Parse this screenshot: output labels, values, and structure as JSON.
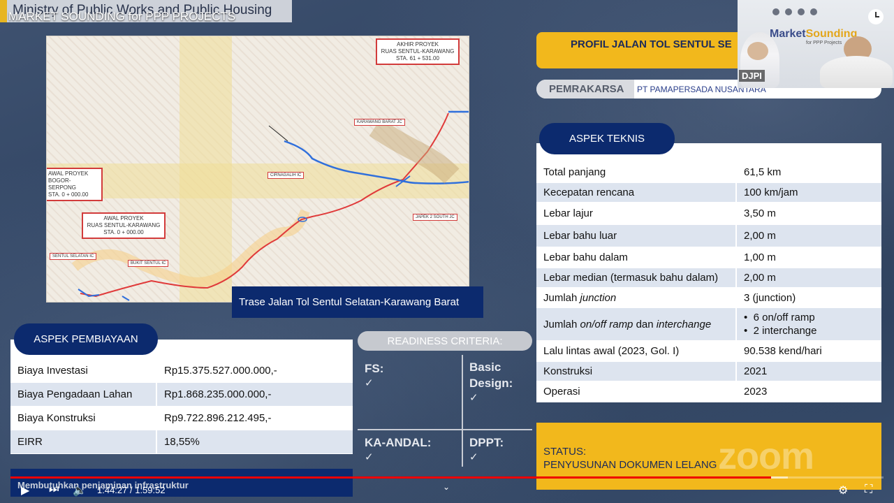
{
  "header": {
    "ministry": "Ministry of Public Works and Public Housing",
    "video_title": "MARKET SOUNDING for PPP PROJECTS"
  },
  "map": {
    "caption": "Trase Jalan Tol Sentul Selatan-Karawang Barat",
    "labels": {
      "akhir": [
        "AKHIR PROYEK",
        "RUAS SENTUL-KARAWANG",
        "STA. 61 + 531.00"
      ],
      "awal_bogor": [
        "AWAL PROYEK",
        "BOGOR-SERPONG",
        "STA. 0 + 000.00"
      ],
      "awal_sentul": [
        "AWAL PROYEK",
        "RUAS SENTUL-KARAWANG",
        "STA. 0 + 000.00"
      ],
      "karawang_barat": "KARAWANG BARAT JC",
      "cirinagalih": "CIRNAGALIH IC",
      "japek": "JAPEK 2 SOUTH JC",
      "sentul_selatan": "SENTUL SELATAN IC",
      "bukit_sentul": "BUKIT SENTUL IC"
    }
  },
  "profil": {
    "title": "PROFIL JALAN TOL SENTUL SE",
    "pemrakarsa_label": "PEMRAKARSA",
    "pemrakarsa_value": "PT PAMAPERSADA NUSANTARA"
  },
  "teknis": {
    "title": "ASPEK TEKNIS",
    "rows": [
      {
        "label": "Total panjang",
        "value": "61,5 km"
      },
      {
        "label": "Kecepatan rencana",
        "value": "100 km/jam"
      },
      {
        "label": "Lebar lajur",
        "value": "3,50 m"
      },
      {
        "label": "Lebar bahu luar",
        "value": "2,00 m"
      },
      {
        "label": "Lebar bahu dalam",
        "value": "1,00 m"
      },
      {
        "label": "Lebar median (termasuk bahu dalam)",
        "value": "2,00 m"
      },
      {
        "label_pre": "Jumlah ",
        "label_em": "junction",
        "value": "3 (junction)"
      },
      {
        "label_pre": "Jumlah ",
        "label_em": "on/off ramp",
        "label_mid": " dan ",
        "label_em2": "interchange",
        "value_1": "6 on/off ramp",
        "value_2": "2 interchange"
      },
      {
        "label": "Lalu lintas awal (2023, Gol. I)",
        "value": "90.538 kend/hari"
      },
      {
        "label": "Konstruksi",
        "value": "2021"
      },
      {
        "label": "Operasi",
        "value": "2023"
      }
    ]
  },
  "status": {
    "line1": "STATUS:",
    "line2": "PENYUSUNAN DOKUMEN LELANG"
  },
  "pembiayaan": {
    "title": "ASPEK PEMBIAYAAN",
    "rows": [
      {
        "label": "Biaya Investasi",
        "value": "Rp15.375.527.000.000,-"
      },
      {
        "label": "Biaya Pengadaan Lahan",
        "value": "Rp1.868.235.000.000,-"
      },
      {
        "label": "Biaya Konstruksi",
        "value": "Rp9.722.896.212.495,-"
      },
      {
        "label": "EIRR",
        "value": "18,55%"
      }
    ]
  },
  "banner": "Membutuhkan penjaminan infrastruktur",
  "readiness": {
    "title": "READINESS CRITERIA:",
    "fs": "FS:",
    "basic1": "Basic",
    "basic2": "Design:",
    "kaandal": "KA-ANDAL:",
    "dppt": "DPPT:",
    "check": "✓"
  },
  "zoom_inset": {
    "logo_a": "Market",
    "logo_b": "Sounding",
    "sub": "for PPP Projects",
    "name_tag": "DJPI"
  },
  "watermark": "zoom",
  "player": {
    "time": "1:44:27 / 1:59:52",
    "progress": 0.871,
    "buffered": 0.89,
    "play_icon": "▶",
    "next_icon": "⏭",
    "volume_icon": "🔈",
    "settings_icon": "⚙",
    "fullscreen_icon": "⛶",
    "chevron": "⌄"
  },
  "colors": {
    "navy": "#0c2a6e",
    "gold": "#f2b81c",
    "route_red": "#e03a3a",
    "route_blue": "#2f6fdc",
    "progress_red": "#ee0000"
  }
}
